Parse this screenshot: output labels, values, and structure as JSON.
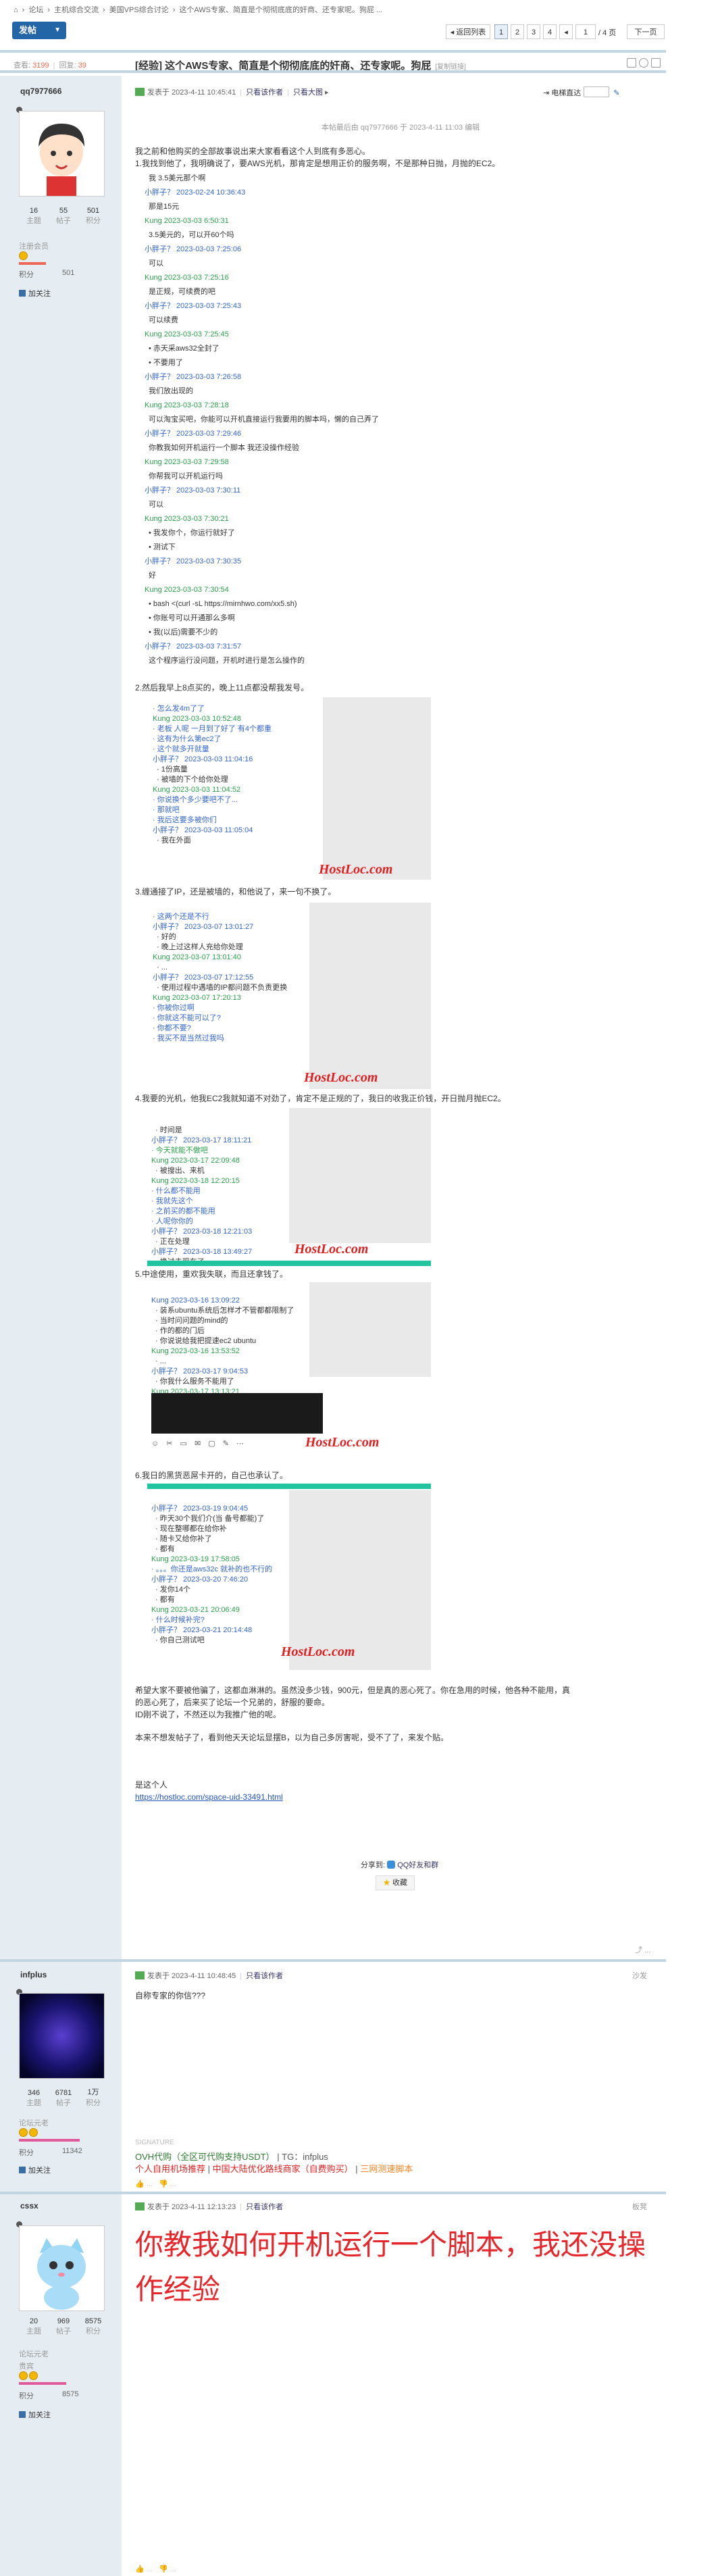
{
  "breadcrumb": [
    "⌂",
    "›",
    "论坛",
    "›",
    "主机综合交流",
    "›",
    "美国VPS综合讨论",
    "›",
    "这个AWS专家、简直是个彻彻底底的奸商、还专家呢。狗屁 ..."
  ],
  "toolbar": {
    "new_label": "发帖",
    "back_label": "返回列表",
    "pages": [
      "1",
      "2",
      "3",
      "4"
    ],
    "page_input": "1",
    "page_total": "/ 4 页",
    "next_label": "下一页"
  },
  "stats": {
    "views_label": "查看:",
    "views": "3199",
    "replies_label": "回复:",
    "replies": "39"
  },
  "thread": {
    "title": "[经验] 这个AWS专家、简直是个彻彻底底的奸商、还专家呢。狗屁",
    "copy_link": "[复制链接]"
  },
  "post1": {
    "username": "qq7977666",
    "stats": [
      {
        "v": "16",
        "l": "主题"
      },
      {
        "v": "55",
        "l": "帖子"
      },
      {
        "v": "501",
        "l": "积分"
      }
    ],
    "level": "注册会员",
    "score_label": "积分",
    "score": "501",
    "add_friend": "加关注",
    "meta": "发表于 2023-4-11 10:45:41",
    "only_author": "只看该作者",
    "only_big": "只看大图",
    "postno": "楼主",
    "elec": "电梯直达",
    "edit_note": "本帖最后由 qq7977666 于 2023-4-11 11:03 编辑",
    "intro": [
      "我之前和他购买的全部故事说出来大家看看这个人到底有多恶心。",
      "1.我找到他了，我明确说了，要AWS光机，那肯定是想用正价的服务啊，不是那种日抛，月抛的EC2。"
    ],
    "chat1": [
      {
        "t": "k",
        "s": "我 3.5美元那个啊"
      },
      {
        "t": "b",
        "s": "小胖子？ 2023-02-24 10:36:43"
      },
      {
        "t": "k",
        "s": "那是15元"
      },
      {
        "t": "g",
        "s": "Kung 2023-03-03 6:50:31"
      },
      {
        "t": "k",
        "s": "3.5美元的，可以开60个吗"
      },
      {
        "t": "b",
        "s": "小胖子？ 2023-03-03 7:25:06"
      },
      {
        "t": "k",
        "s": "可以"
      },
      {
        "t": "g",
        "s": "Kung 2023-03-03 7:25:16"
      },
      {
        "t": "k",
        "s": "是正规，可续费的吧"
      },
      {
        "t": "b",
        "s": "小胖子？ 2023-03-03 7:25:43"
      },
      {
        "t": "k",
        "s": "可以续费"
      },
      {
        "t": "g",
        "s": "Kung 2023-03-03 7:25:45"
      },
      {
        "t": "k",
        "s": "• 赤天采aws32全封了"
      },
      {
        "t": "k",
        "s": "• 不要用了"
      },
      {
        "t": "b",
        "s": "小胖子？ 2023-03-03 7:26:58"
      },
      {
        "t": "k",
        "s": "我们放出现的"
      },
      {
        "t": "g",
        "s": "Kung 2023-03-03 7:28:18"
      },
      {
        "t": "k",
        "s": "可以淘宝买吧，你能可以开机直接运行我要用的脚本吗，懒的自己弄了"
      },
      {
        "t": "b",
        "s": "小胖子？ 2023-03-03 7:29:46"
      },
      {
        "t": "k",
        "s": "你教我如何开机运行一个脚本 我还没操作经验"
      },
      {
        "t": "g",
        "s": "Kung 2023-03-03 7:29:58"
      },
      {
        "t": "k",
        "s": "你帮我可以开机运行吗"
      },
      {
        "t": "b",
        "s": "小胖子？ 2023-03-03 7:30:11"
      },
      {
        "t": "k",
        "s": "可以"
      },
      {
        "t": "g",
        "s": "Kung 2023-03-03 7:30:21"
      },
      {
        "t": "k",
        "s": "• 我发你个，你运行就好了"
      },
      {
        "t": "k",
        "s": "• 测试下"
      },
      {
        "t": "b",
        "s": "小胖子？ 2023-03-03 7:30:35"
      },
      {
        "t": "k",
        "s": "好"
      },
      {
        "t": "g",
        "s": "Kung 2023-03-03 7:30:54"
      },
      {
        "t": "k",
        "s": "• bash <(curl -sL https://mirnhwo.com/xx5.sh)"
      },
      {
        "t": "k",
        "s": "• 你账号可以开通那么多啊"
      },
      {
        "t": "k",
        "s": "• 我(以后)需要不少的"
      },
      {
        "t": "b",
        "s": "小胖子？ 2023-03-03 7:31:57"
      },
      {
        "t": "k",
        "s": "这个程序运行没问题，开机时进行是怎么操作的"
      }
    ],
    "sec2": "2.然后我早上8点买的，晚上11点都没帮我发号。",
    "sec3": "3.缠通接了IP，还是被墙的，和他说了，来一句不换了。",
    "sec4": "4.我要的光机，他我EC2我就知道不对劲了，肯定不是正规的了，我日的收我正价钱，开日抛月抛EC2。",
    "sec5": "5.中途使用，重欢我失联，而且还拿钱了。",
    "sec6": "6.我日的黑货恶屌卡开的，自己也承认了。",
    "watermark": "HostLoc.com",
    "para1": "希望大家不要被他骗了，这都血淋淋的。虽然没多少钱，900元，但是真的恶心死了。你在急用的时候，他各种不能用，真",
    "para1b": "的恶心死了，后来买了论坛一个兄弟的，舒服的要命。",
    "para1c": "ID刚不说了，不然还以为我推广他的呢。",
    "para2": "本来不想发帖子了，看到他天天论坛显摆B，以为自己多厉害呢，受不了了，来发个贴。",
    "space_label": "是这个人",
    "space_link": "https://hostloc.com/space-uid-33491.html",
    "share_label": "分享到:",
    "share_qq": "QQ好友和群",
    "fav_label": "收藏"
  },
  "post2": {
    "username": "infplus",
    "stats": [
      {
        "v": "346",
        "l": "主题"
      },
      {
        "v": "6781",
        "l": "帖子"
      },
      {
        "v": "1万",
        "l": "积分"
      }
    ],
    "level": "论坛元老",
    "score_label": "积分",
    "score": "11342",
    "add_friend": "加关注",
    "meta": "发表于 2023-4-11 10:48:45",
    "only_author": "只看该作者",
    "postno": "沙发",
    "content": "自称专家的你信???",
    "sig_label": "SIGNATURE",
    "sig1a": "OVH代购（全区可代购支持USDT）",
    "sig1b": "| TG：infplus",
    "sig2a": "个人自用机场推荐",
    "sig2b": "中国大陆优化路线商家（自费购买）",
    "sig2c": "三网测速脚本"
  },
  "post3": {
    "username": "cssx",
    "stats": [
      {
        "v": "20",
        "l": "主题"
      },
      {
        "v": "969",
        "l": "帖子"
      },
      {
        "v": "8575",
        "l": "积分"
      }
    ],
    "level": "论坛元老",
    "title2": "贵宾",
    "score_label": "积分",
    "score": "8575",
    "add_friend": "加关注",
    "meta": "发表于 2023-4-11 12:13:23",
    "only_author": "只看该作者",
    "postno": "板凳",
    "content": "你教我如何开机运行一个脚本，我还没操作经验"
  },
  "colors": {
    "accent": "#2366a8",
    "sidebar": "#e5edf2",
    "separator": "#c2d5e3",
    "red": "#e5262b"
  }
}
